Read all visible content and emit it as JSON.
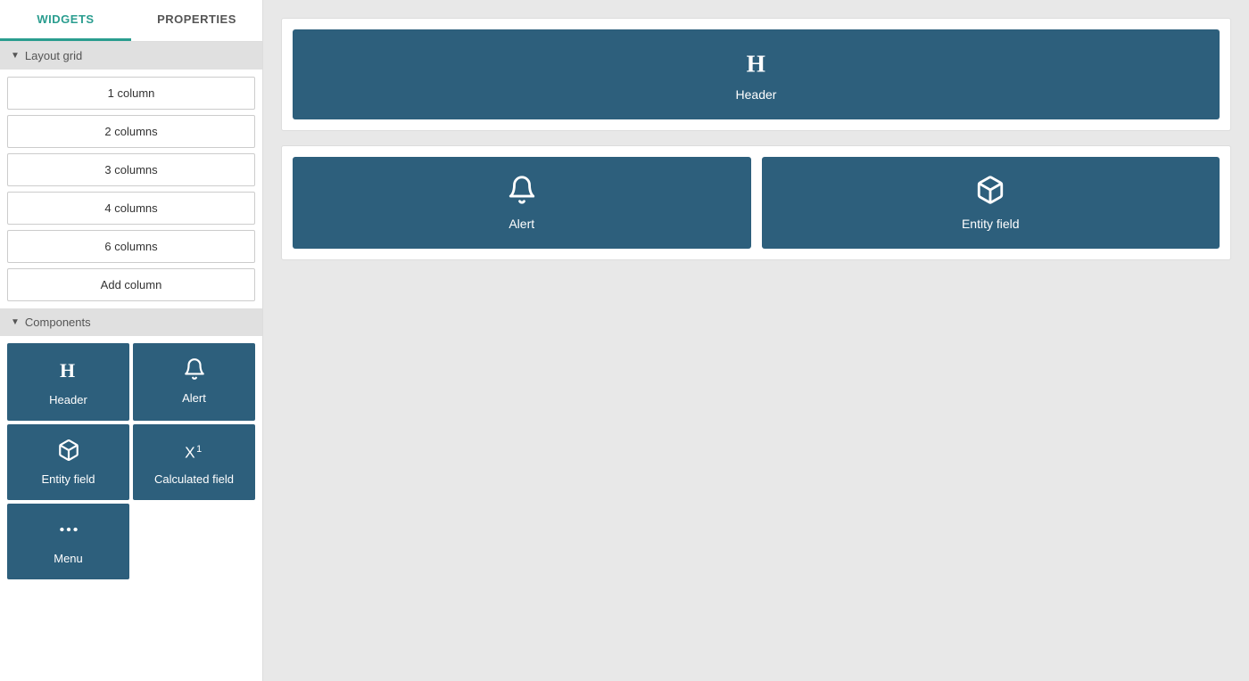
{
  "sidebar": {
    "tabs": [
      {
        "label": "WIDGETS",
        "active": true
      },
      {
        "label": "PROPERTIES",
        "active": false
      }
    ],
    "layout_grid": {
      "section_label": "Layout grid",
      "buttons": [
        "1 column",
        "2 columns",
        "3 columns",
        "4 columns",
        "6 columns",
        "Add column"
      ]
    },
    "components": {
      "section_label": "Components",
      "items": [
        {
          "id": "header",
          "label": "Header",
          "icon": "header"
        },
        {
          "id": "alert",
          "label": "Alert",
          "icon": "bell"
        },
        {
          "id": "entity-field",
          "label": "Entity field",
          "icon": "box"
        },
        {
          "id": "calculated-field",
          "label": "Calculated field",
          "icon": "calc"
        },
        {
          "id": "menu",
          "label": "Menu",
          "icon": "menu"
        }
      ]
    }
  },
  "canvas": {
    "rows": [
      {
        "id": "row1",
        "widgets": [
          {
            "id": "header-1",
            "type": "header",
            "label": "Header",
            "icon": "header",
            "full": true
          }
        ]
      },
      {
        "id": "row2",
        "widgets": [
          {
            "id": "alert-1",
            "type": "alert",
            "label": "Alert",
            "icon": "bell"
          },
          {
            "id": "entity-field-1",
            "type": "entity-field",
            "label": "Entity field",
            "icon": "box"
          }
        ]
      }
    ]
  }
}
